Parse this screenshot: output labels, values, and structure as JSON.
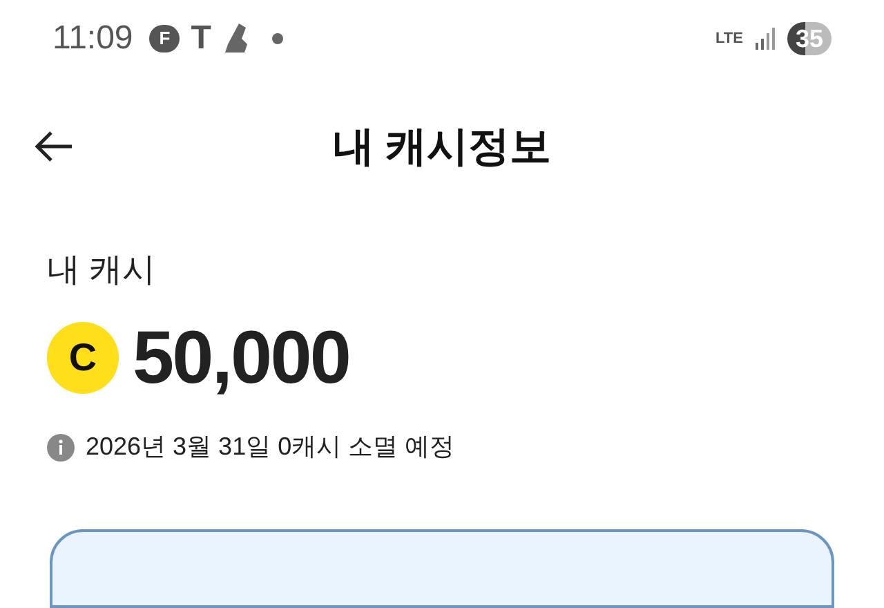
{
  "status_bar": {
    "time": "11:09",
    "notification_letters": [
      "F",
      "T"
    ],
    "network": "LTE",
    "battery": "35"
  },
  "header": {
    "title": "내 캐시정보"
  },
  "cash": {
    "label": "내 캐시",
    "coin": "C",
    "amount": "50,000",
    "notice": "2026년 3월 31일 0캐시 소멸 예정"
  }
}
